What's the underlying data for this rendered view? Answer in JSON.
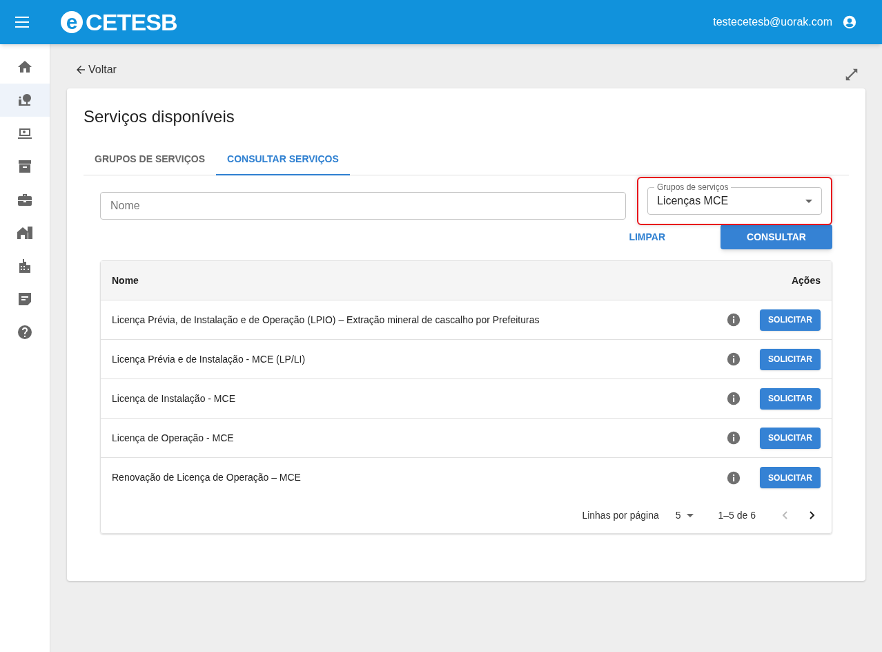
{
  "header": {
    "logo_mark": "e",
    "logo_text": "CETESB",
    "user_email": "testecetesb@uorak.com"
  },
  "sidebar": {
    "items": [
      {
        "selected": false
      },
      {
        "selected": true
      },
      {
        "selected": false
      },
      {
        "selected": false
      },
      {
        "selected": false
      },
      {
        "selected": false
      },
      {
        "selected": false
      },
      {
        "selected": false
      },
      {
        "selected": false
      }
    ]
  },
  "back_link": "Voltar",
  "card": {
    "title": "Serviços disponíveis",
    "tabs": [
      {
        "label": "GRUPOS DE SERVIÇOS",
        "selected": false
      },
      {
        "label": "CONSULTAR SERVIÇOS",
        "selected": true
      }
    ],
    "name_field": {
      "placeholder": "Nome"
    },
    "group_select": {
      "label": "Grupos de serviços",
      "value": "Licenças MCE",
      "highlighted": true
    },
    "buttons": {
      "clear": "LIMPAR",
      "search": "CONSULTAR"
    },
    "table": {
      "columns": [
        "Nome",
        "Ações"
      ],
      "rows": [
        {
          "name": "Licença Prévia, de Instalação e de Operação (LPIO) – Extração mineral de cascalho por Prefeituras",
          "action": "SOLICITAR"
        },
        {
          "name": "Licença Prévia e de Instalação - MCE (LP/LI)",
          "action": "SOLICITAR"
        },
        {
          "name": "Licença de Instalação - MCE",
          "action": "SOLICITAR"
        },
        {
          "name": "Licença de Operação - MCE",
          "action": "SOLICITAR"
        },
        {
          "name": "Renovação de Licença de Operação – MCE",
          "action": "SOLICITAR"
        }
      ],
      "pagination": {
        "rows_per_page_label": "Linhas por página",
        "rows_per_page": "5",
        "range": "1–5 de 6",
        "prev_disabled": true,
        "next_disabled": false
      }
    }
  }
}
